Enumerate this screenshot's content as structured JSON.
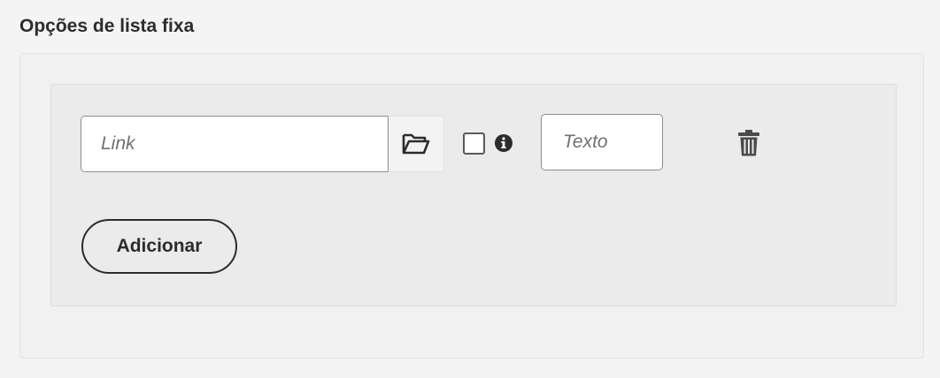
{
  "section": {
    "title": "Opções de lista fixa"
  },
  "item": {
    "link_placeholder": "Link",
    "text_placeholder": "Texto",
    "checkbox_checked": false
  },
  "actions": {
    "add_label": "Adicionar"
  },
  "icons": {
    "browse": "folder-open-icon",
    "info": "info-icon",
    "delete": "trash-icon"
  },
  "colors": {
    "page_bg": "#f4f4f4",
    "panel_bg": "#f1f1f1",
    "inner_bg": "#ebebeb",
    "text": "#2c2c2c",
    "border": "#8e8e8e"
  }
}
